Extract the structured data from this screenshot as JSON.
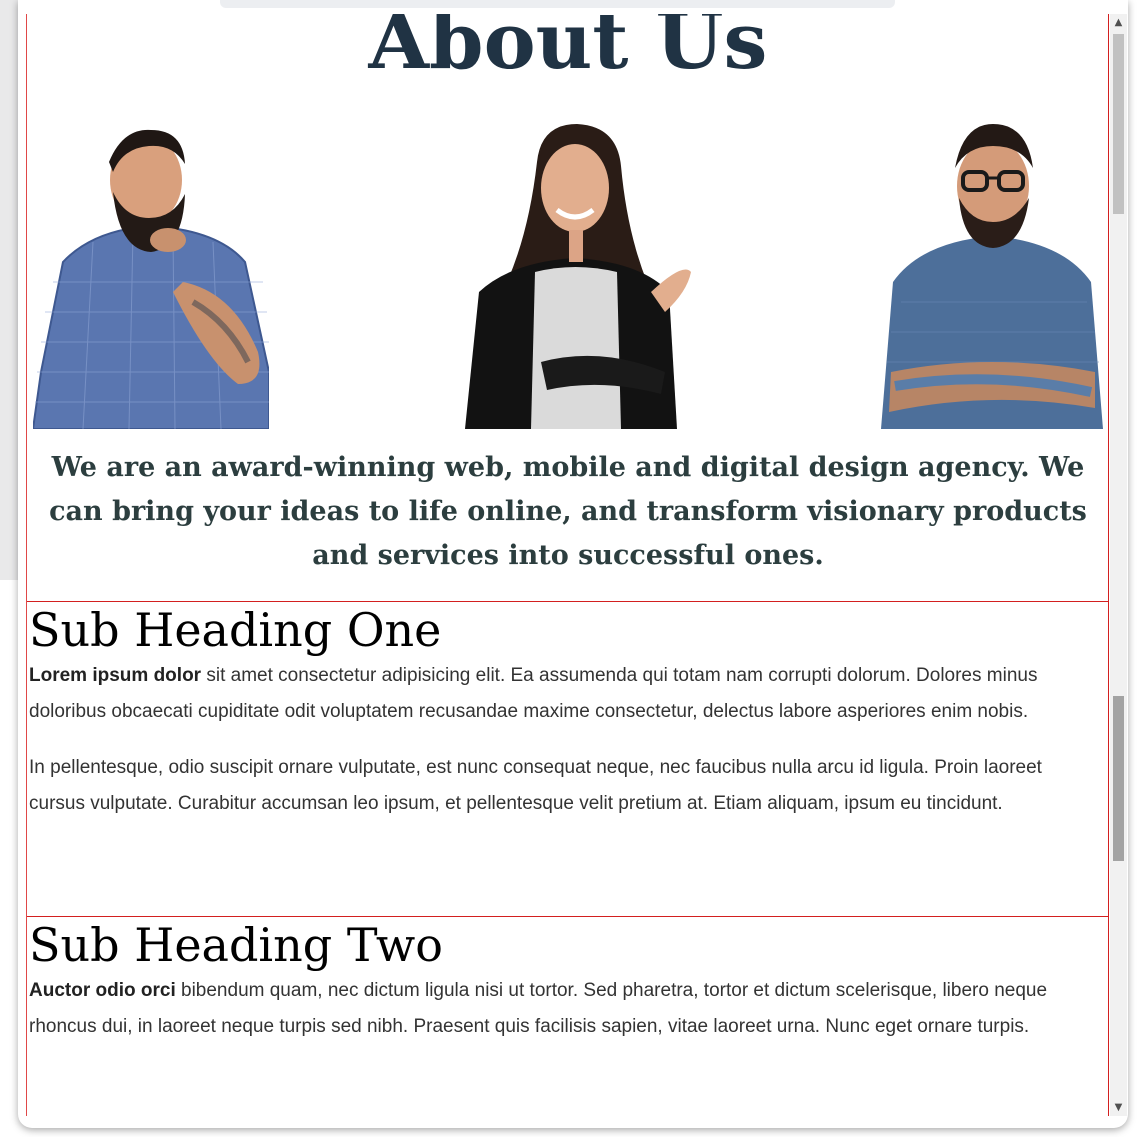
{
  "hero": {
    "title": "About Us",
    "lead": "We are an award-winning web, mobile and digital design agency. We can bring your ideas to life online, and transform visionary products and services into successful ones."
  },
  "team_images": [
    {
      "name": "bearded-man-thinking"
    },
    {
      "name": "smiling-woman"
    },
    {
      "name": "man-with-glasses-arms-crossed"
    }
  ],
  "section_one": {
    "heading": "Sub Heading One",
    "p1_bold": "Lorem ipsum dolor",
    "p1_rest": " sit amet consectetur adipisicing elit. Ea assumenda qui totam nam corrupti dolorum. Dolores minus doloribus obcaecati cupiditate odit voluptatem recusandae maxime consectetur, delectus labore asperiores enim nobis.",
    "p2": "In pellentesque, odio suscipit ornare vulputate, est nunc consequat neque, nec faucibus nulla arcu id ligula. Proin laoreet cursus vulputate. Curabitur accumsan leo ipsum, et pellentesque velit pretium at. Etiam aliquam, ipsum eu tincidunt."
  },
  "section_two": {
    "heading": "Sub Heading Two",
    "p1_bold": "Auctor odio orci",
    "p1_rest": " bibendum quam, nec dictum ligula nisi ut tortor. Sed pharetra, tortor et dictum scelerisque, libero neque rhoncus dui, in laoreet neque turpis sed nibh. Praesent quis facilisis sapien, vitae laoreet urna. Nunc eget ornare turpis."
  },
  "scrollbar": {
    "up_arrow": "▲",
    "down_arrow": "▼"
  },
  "colors": {
    "title": "#203344",
    "lead": "#2c3e3f",
    "outline": "#d31f1f"
  }
}
